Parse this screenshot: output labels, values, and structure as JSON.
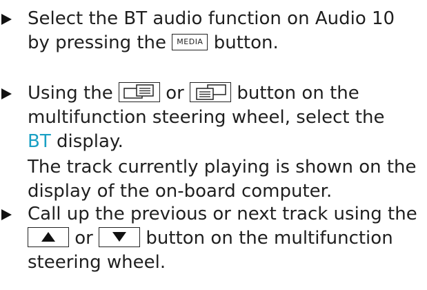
{
  "steps": [
    {
      "lines": {
        "l1": "Select the BT audio function on Audio 10",
        "l2_before": "by pressing the",
        "button": "MEDIA",
        "l2_after": "button."
      }
    },
    {
      "lines": {
        "l1_before": "Using the",
        "button_left": "page-back-icon",
        "l1_mid": "or",
        "button_right": "page-forward-icon",
        "l1_after": "button on the",
        "l2": "multifunction steering wheel, select the",
        "display_name": "BT",
        "l3_after": "display.",
        "note_l1": "The track currently playing is shown on the",
        "note_l2": "display of the on-board computer."
      }
    },
    {
      "lines": {
        "l1": "Call up the previous or next track using the",
        "button_up": "up-arrow-icon",
        "l2_mid": "or",
        "button_down": "down-arrow-icon",
        "l2_after": "button on the multifunction",
        "l3": "steering wheel."
      }
    }
  ],
  "colors": {
    "text": "#1f1f1f",
    "accent": "#1aa0c4"
  }
}
